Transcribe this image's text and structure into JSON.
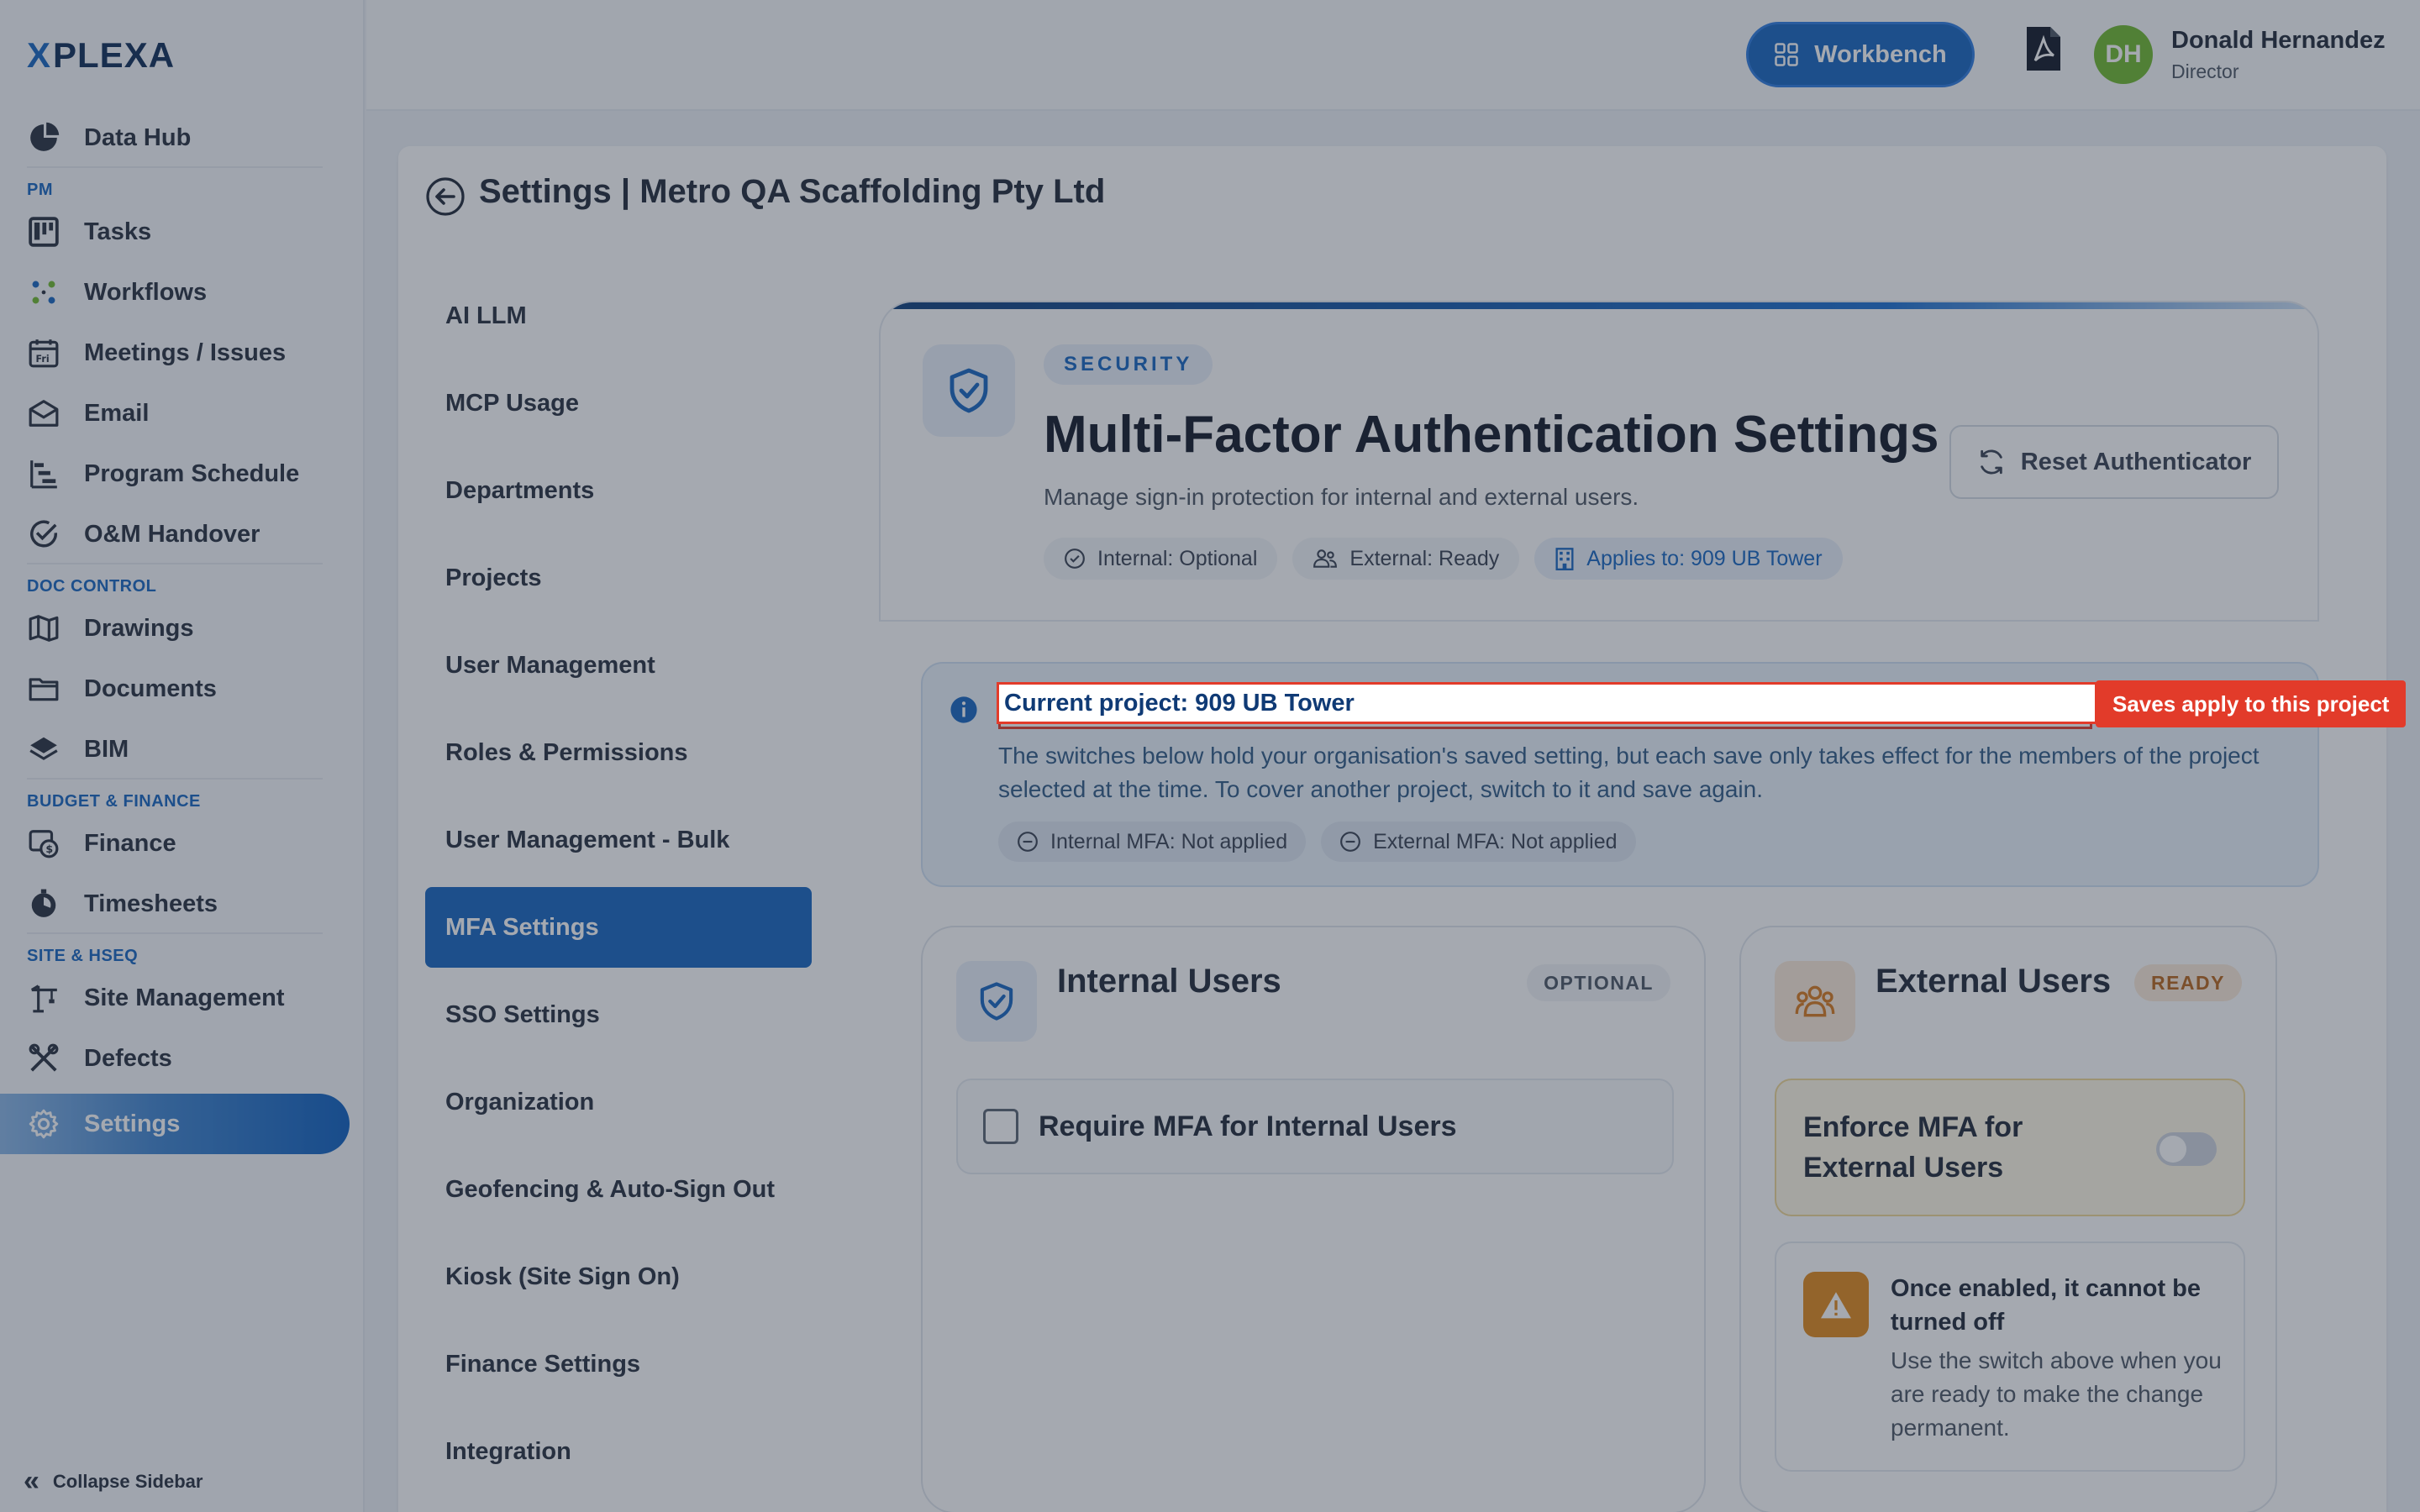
{
  "brand": {
    "logo_text": "PLEXA",
    "logo_prefix": "X"
  },
  "sidebar": {
    "items": [
      {
        "label": "Data Hub",
        "icon": "pie-chart-icon"
      },
      {
        "section": "PM"
      },
      {
        "label": "Tasks",
        "icon": "kanban-icon"
      },
      {
        "label": "Workflows",
        "icon": "workflow-icon"
      },
      {
        "label": "Meetings / Issues",
        "icon": "calendar-icon"
      },
      {
        "label": "Email",
        "icon": "mail-icon"
      },
      {
        "label": "Program Schedule",
        "icon": "gantt-icon"
      },
      {
        "label": "O&M Handover",
        "icon": "check-circle-icon"
      },
      {
        "section": "DOC CONTROL"
      },
      {
        "label": "Drawings",
        "icon": "map-icon"
      },
      {
        "label": "Documents",
        "icon": "folder-icon"
      },
      {
        "label": "BIM",
        "icon": "layers-icon"
      },
      {
        "section": "BUDGET & FINANCE"
      },
      {
        "label": "Finance",
        "icon": "finance-icon"
      },
      {
        "label": "Timesheets",
        "icon": "timer-icon"
      },
      {
        "section": "SITE & HSEQ"
      },
      {
        "label": "Site Management",
        "icon": "crane-icon"
      },
      {
        "label": "Defects",
        "icon": "tools-icon"
      },
      {
        "label": "Settings",
        "icon": "gear-icon",
        "active": true
      }
    ],
    "collapse_label": "Collapse Sidebar"
  },
  "header": {
    "workbench_label": "Workbench",
    "user": {
      "initials": "DH",
      "name": "Donald Hernandez",
      "role": "Director"
    }
  },
  "page": {
    "title": "Settings | Metro QA Scaffolding Pty Ltd"
  },
  "settings_nav": [
    "AI LLM",
    "MCP Usage",
    "Departments",
    "Projects",
    "User Management",
    "Roles & Permissions",
    "User Management - Bulk",
    "MFA Settings",
    "SSO Settings",
    "Organization",
    "Geofencing & Auto-Sign Out",
    "Kiosk (Site Sign On)",
    "Finance Settings",
    "Integration"
  ],
  "settings_nav_active": "MFA Settings",
  "security": {
    "badge": "SECURITY",
    "title": "Multi-Factor Authentication Settings",
    "subtitle": "Manage sign-in protection for internal and external users.",
    "chips": {
      "internal": "Internal: Optional",
      "external": "External: Ready",
      "applies": "Applies to: 909 UB Tower"
    },
    "reset_label": "Reset Authenticator"
  },
  "info": {
    "title": "Current project: 909 UB Tower",
    "tag": "Saves apply to this project",
    "text": "The switches below hold your organisation's saved setting, but each save only takes effect for the members of the project selected at the time. To cover another project, switch to it and save again.",
    "chips": {
      "internal": "Internal MFA: Not applied",
      "external": "External MFA: Not applied"
    }
  },
  "internal_card": {
    "title": "Internal Users",
    "badge": "OPTIONAL",
    "checkbox_label": "Require MFA for Internal Users",
    "checked": false
  },
  "external_card": {
    "title": "External Users",
    "badge": "READY",
    "toggle_label": "Enforce MFA for External Users",
    "toggle_on": false,
    "warning_title": "Once enabled, it cannot be turned off",
    "warning_text": "Use the switch above when you are ready to make the change permanent."
  },
  "colors": {
    "primary": "#1565c0",
    "highlight_red": "#e23b2a",
    "avatar_green": "#6fb82e",
    "warning_orange": "#e0891a"
  }
}
